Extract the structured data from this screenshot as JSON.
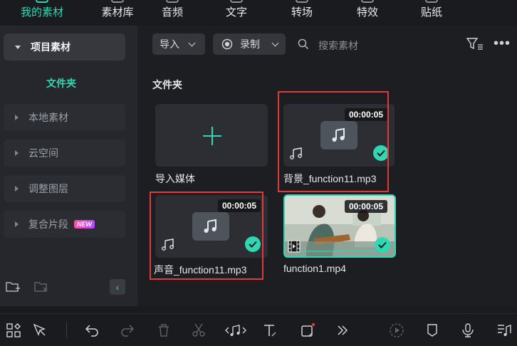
{
  "tabs": [
    {
      "label": "我的素材",
      "active": true
    },
    {
      "label": "素材库"
    },
    {
      "label": "音频"
    },
    {
      "label": "文字"
    },
    {
      "label": "转场"
    },
    {
      "label": "特效"
    },
    {
      "label": "贴纸"
    }
  ],
  "sidebar": {
    "project": "项目素材",
    "folder": "文件夹",
    "items": [
      "本地素材",
      "云空间",
      "调整图层",
      "复合片段"
    ],
    "new_badge": "NEW"
  },
  "toolbar": {
    "import": "导入",
    "record": "录制",
    "search_placeholder": "搜索素材"
  },
  "main": {
    "section_title": "文件夹",
    "import_media": "导入媒体",
    "items": [
      {
        "name": "背景_function11.mp3",
        "duration": "00:00:05"
      },
      {
        "name": "声音_function11.mp3",
        "duration": "00:00:05"
      },
      {
        "name": "function1.mp4",
        "duration": "00:00:05"
      }
    ]
  },
  "colors": {
    "accent": "#2fd8b3",
    "highlight": "#e03a3a"
  }
}
